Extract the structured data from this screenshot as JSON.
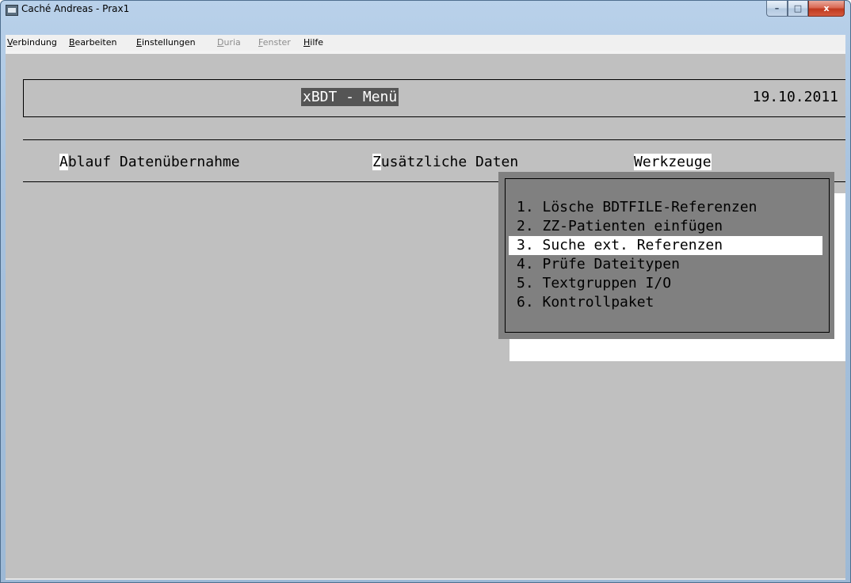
{
  "window": {
    "title": "Caché Andreas - Prax1"
  },
  "controls": {
    "minimize": "–",
    "maximize": "□",
    "close": "x"
  },
  "menubar": [
    "Verbindung",
    "Bearbeiten",
    "Einstellungen",
    "Duria",
    "Fenster",
    "Hilfe"
  ],
  "header": {
    "title": "xBDT - Menü",
    "date": "19.10.2011"
  },
  "menu": {
    "items": [
      {
        "hotkey": "A",
        "rest": "blauf Datenübernahme"
      },
      {
        "hotkey": "Z",
        "rest": "usätzliche Daten"
      },
      {
        "label": "Werkzeuge"
      }
    ]
  },
  "dropdown": {
    "items": [
      "1. Lösche BDTFILE-Referenzen",
      "2. ZZ-Patienten einfügen",
      "3. Suche ext. Referenzen",
      "4. Prüfe Dateitypen",
      "5. Textgruppen I/O",
      "6. Kontrollpaket"
    ],
    "selected_index": 2
  },
  "colors": {
    "terminal_bg": "#c0c0c0",
    "dropdown_bg": "#808080",
    "highlight": "#ffffff",
    "title_bg": "#555555"
  }
}
